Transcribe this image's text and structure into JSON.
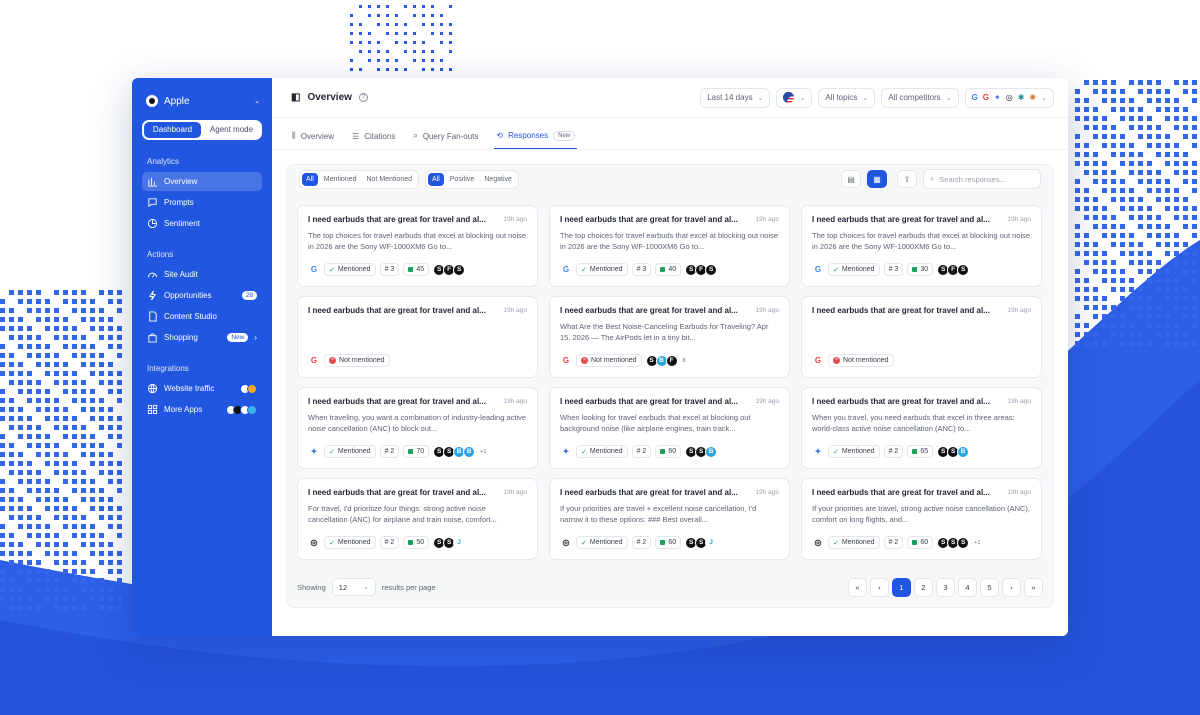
{
  "sidebar": {
    "brand": "Apple",
    "modes": [
      "Dashboard",
      "Agent mode"
    ],
    "analytics_label": "Analytics",
    "analytics": [
      "Overview",
      "Prompts",
      "Sentiment"
    ],
    "actions_label": "Actions",
    "actions": [
      "Site Audit",
      "Opportunities",
      "Content Studio",
      "Shopping"
    ],
    "opportunities_badge": "28",
    "shopping_badge": "New",
    "integrations_label": "Integrations",
    "integrations": [
      "Website traffic",
      "More Apps"
    ]
  },
  "header": {
    "title": "Overview",
    "date_filter": "Last 14 days",
    "topics_filter": "All topics",
    "competitors_filter": "All competitors"
  },
  "tabs": [
    "Overview",
    "Citations",
    "Query Fan-outs",
    "Responses"
  ],
  "new_badge": "New",
  "filter_bar": {
    "mention_filters": [
      "All",
      "Mentioned",
      "Not Mentioned"
    ],
    "sentiment_filters": [
      "All",
      "Positive",
      "Negative"
    ],
    "search_placeholder": "Search responses..."
  },
  "cards": [
    {
      "title": "I need earbuds that are great for travel and al...",
      "time": "19h ago",
      "body": "The top choices for travel earbuds that excel at blocking out noise in 2026 are the Sony WF-1000XM6 Go to...",
      "engine": "G",
      "engine_color": "#4285f4",
      "status": "Mentioned",
      "rank": "# 3",
      "score": "45",
      "logos": [
        "S",
        "F",
        "S"
      ],
      "more": ""
    },
    {
      "title": "I need earbuds that are great for travel and al...",
      "time": "19h ago",
      "body": "The top choices for travel earbuds that excel at blocking out noise in 2026 are the Sony WF-1000XM6 Go to...",
      "engine": "G",
      "engine_color": "#4285f4",
      "status": "Mentioned",
      "rank": "# 3",
      "score": "40",
      "logos": [
        "S",
        "F",
        "S"
      ],
      "more": ""
    },
    {
      "title": "I need earbuds that are great for travel and al...",
      "time": "19h ago",
      "body": "The top choices for travel earbuds that excel at blocking out noise in 2026 are the Sony WF-1000XM6 Go to...",
      "engine": "G",
      "engine_color": "#4285f4",
      "status": "Mentioned",
      "rank": "# 3",
      "score": "30",
      "logos": [
        "S",
        "F",
        "S"
      ],
      "more": ""
    },
    {
      "title": "I need earbuds that are great for travel and al...",
      "time": "19h ago",
      "body": "",
      "engine": "G",
      "engine_color": "#ea4335",
      "status": "Not mentioned",
      "rank": "",
      "score": "",
      "logos": [],
      "more": ""
    },
    {
      "title": "I need earbuds that are great for travel and al...",
      "time": "19h ago",
      "body": "What Are the Best Noise-Canceling Earbuds for Traveling? Apr 15, 2026 — The AirPods let in a tiny bit...",
      "engine": "G",
      "engine_color": "#ea4335",
      "status": "Not mentioned",
      "rank": "",
      "score": "",
      "logos": [
        "S",
        "B",
        "F"
      ],
      "more": "8"
    },
    {
      "title": "I need earbuds that are great for travel and al...",
      "time": "19h ago",
      "body": "",
      "engine": "G",
      "engine_color": "#ea4335",
      "status": "Not mentioned",
      "rank": "",
      "score": "",
      "logos": [],
      "more": ""
    },
    {
      "title": "I need earbuds that are great for travel and al...",
      "time": "19h ago",
      "body": "When traveling, you want a combination of industry-leading active noise cancellation (ANC) to block out...",
      "engine": "✦",
      "engine_color": "#3b6fe0",
      "status": "Mentioned",
      "rank": "# 2",
      "score": "70",
      "logos": [
        "S",
        "S",
        "B",
        "B"
      ],
      "more": "+1"
    },
    {
      "title": "I need earbuds that are great for travel and al...",
      "time": "19h ago",
      "body": "When looking for travel earbuds that excel at blocking out background noise (like airplane engines, train track...",
      "engine": "✦",
      "engine_color": "#3b6fe0",
      "status": "Mentioned",
      "rank": "# 2",
      "score": "60",
      "logos": [
        "S",
        "S",
        "B"
      ],
      "more": ""
    },
    {
      "title": "I need earbuds that are great for travel and al...",
      "time": "19h ago",
      "body": "When you travel, you need earbuds that excel in three areas: world-class active noise cancellation (ANC) to...",
      "engine": "✦",
      "engine_color": "#3b6fe0",
      "status": "Mentioned",
      "rank": "# 2",
      "score": "65",
      "logos": [
        "S",
        "S",
        "B"
      ],
      "more": ""
    },
    {
      "title": "I need earbuds that are great for travel and al...",
      "time": "19h ago",
      "body": "For travel, I'd prioritize four things: strong active noise cancellation (ANC) for airplane and train noise, comfort...",
      "engine": "◎",
      "engine_color": "#222222",
      "status": "Mentioned",
      "rank": "# 2",
      "score": "50",
      "logos": [
        "S",
        "S",
        "J"
      ],
      "more": ""
    },
    {
      "title": "I need earbuds that are great for travel and al...",
      "time": "19h ago",
      "body": "If your priorities are travel + excellent noise cancellation, I'd narrow it to these options: ### Best overall...",
      "engine": "◎",
      "engine_color": "#222222",
      "status": "Mentioned",
      "rank": "# 2",
      "score": "60",
      "logos": [
        "S",
        "S",
        "J"
      ],
      "more": ""
    },
    {
      "title": "I need earbuds that are great for travel and al...",
      "time": "19h ago",
      "body": "If your priorities are travel, strong active noise cancellation (ANC), comfort on long flights, and...",
      "engine": "◎",
      "engine_color": "#222222",
      "status": "Mentioned",
      "rank": "# 2",
      "score": "60",
      "logos": [
        "S",
        "S",
        "S"
      ],
      "more": "+1"
    }
  ],
  "pagination": {
    "showing_label": "Showing",
    "per_page": "12",
    "per_page_label": "results per page",
    "pages": [
      "1",
      "2",
      "3",
      "4",
      "5"
    ],
    "current": "1"
  },
  "colors": {
    "accent": "#2156e0",
    "positive": "#19a15a",
    "negative": "#e5484d"
  }
}
